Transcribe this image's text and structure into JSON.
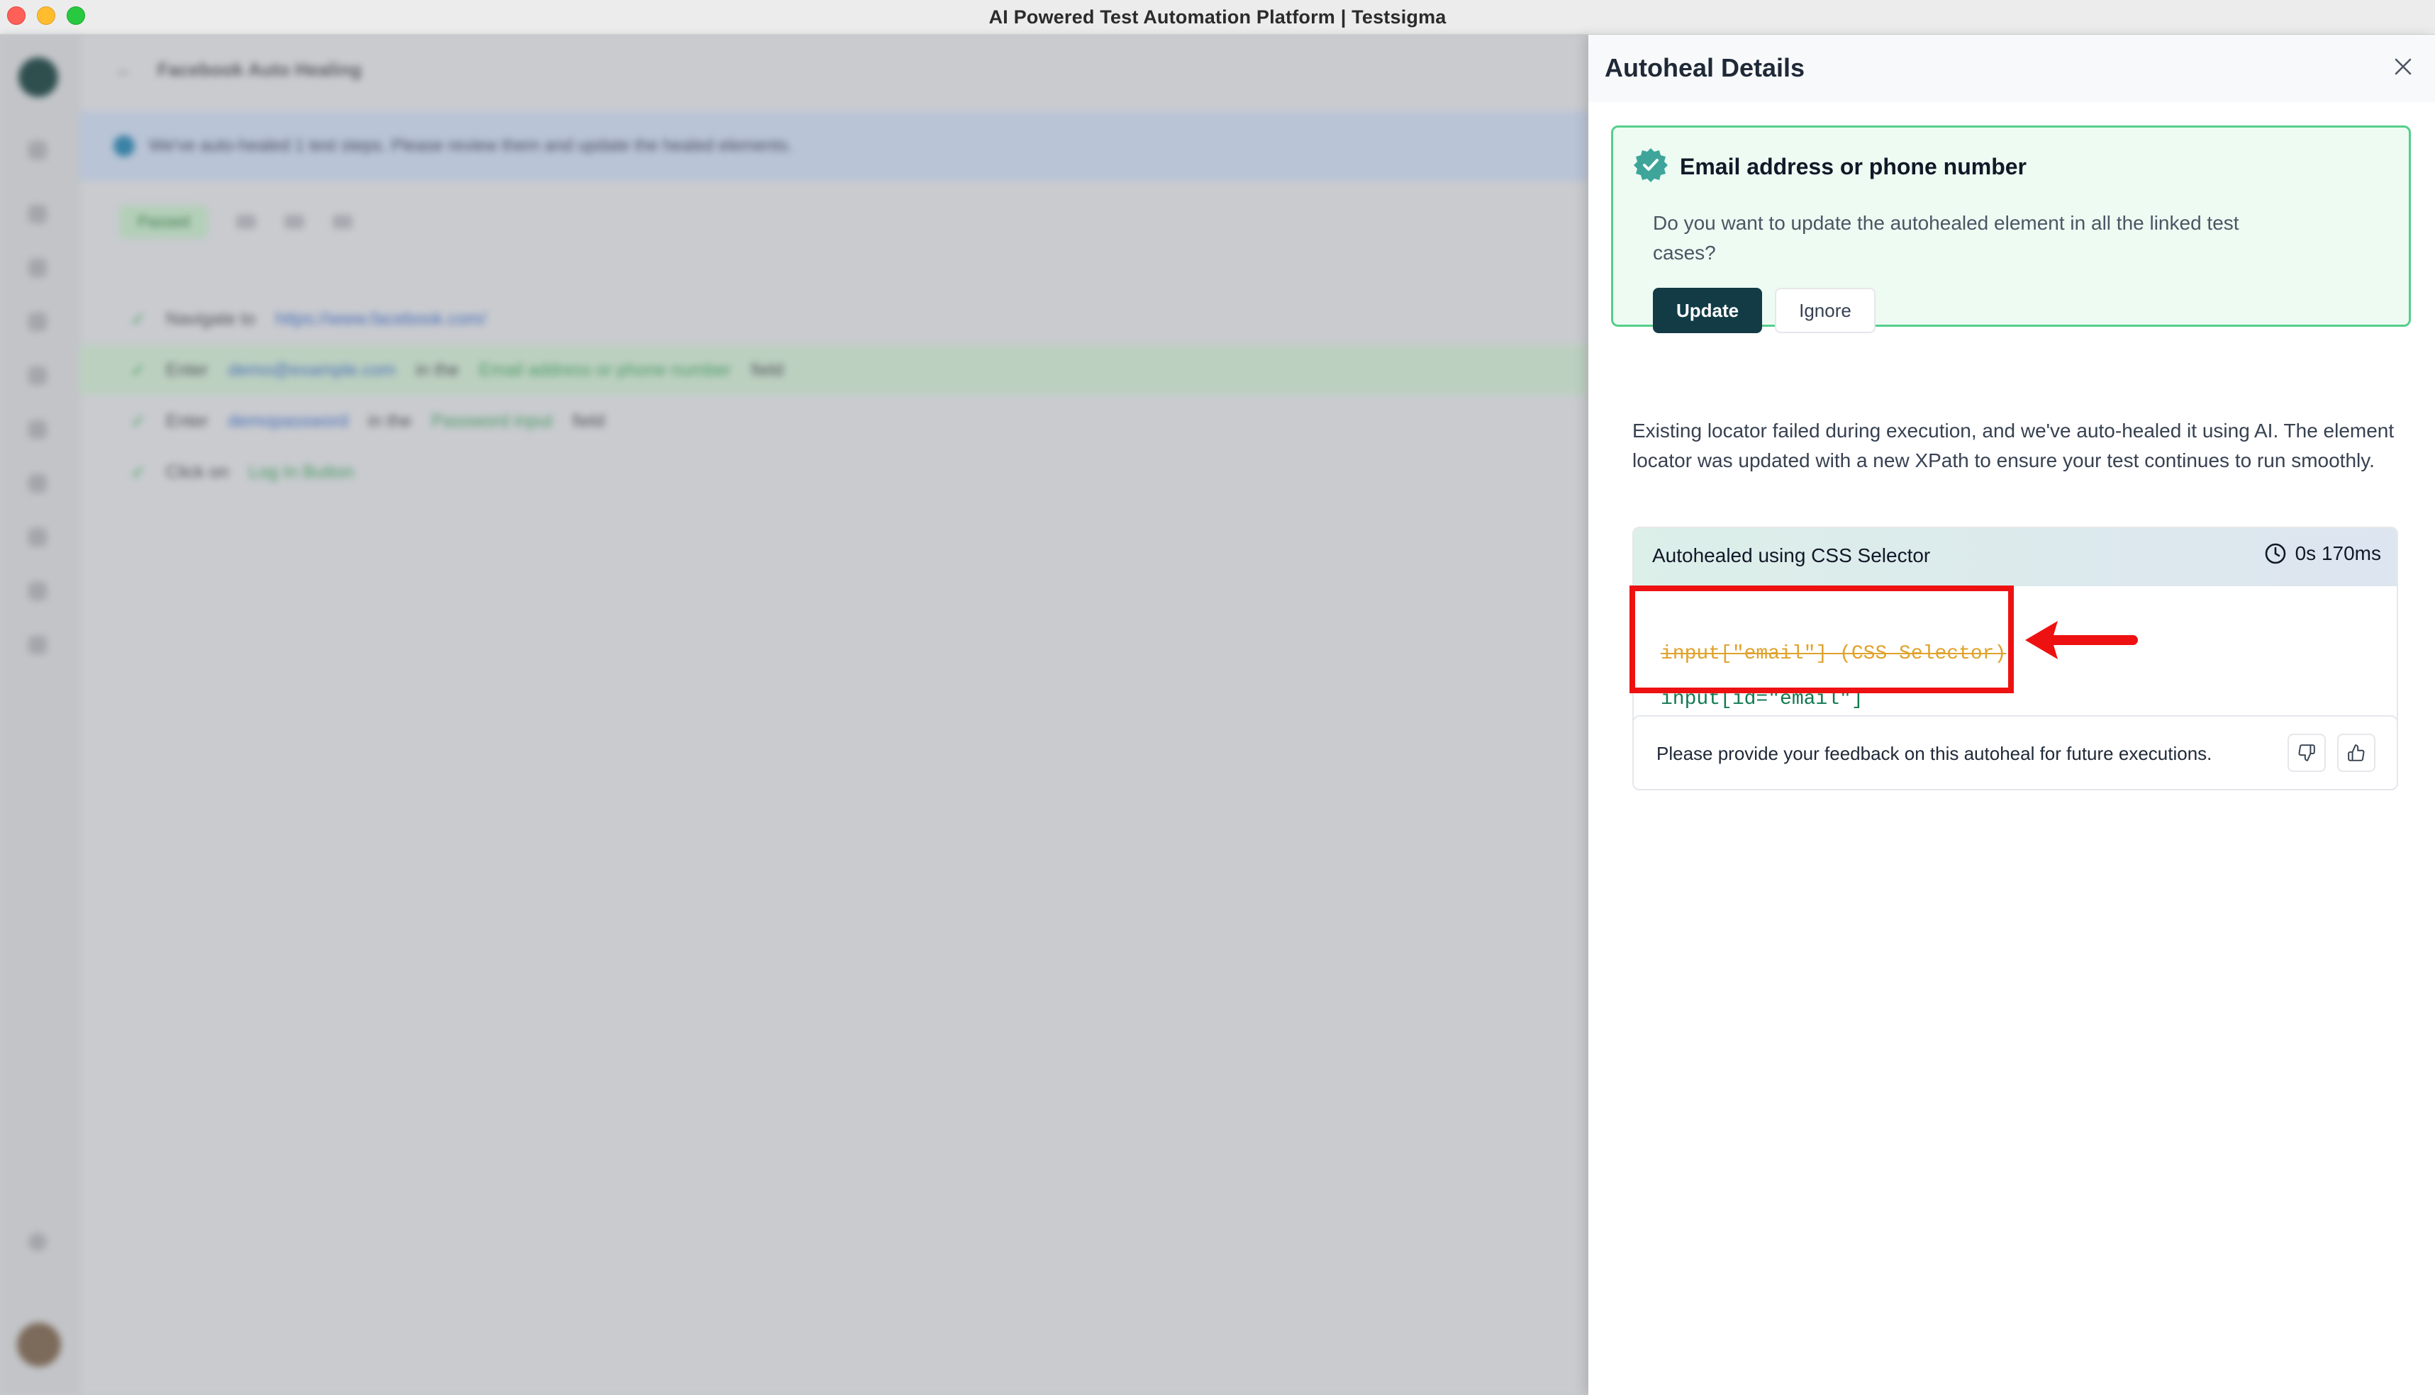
{
  "window": {
    "title": "AI Powered Test Automation Platform | Testsigma"
  },
  "background_app": {
    "test_case_title": "Facebook Auto Healing",
    "banner_text": "We've auto-healed 1 test steps. Please review them and update the healed elements.",
    "status_pill": "Passed",
    "steps": [
      {
        "action": "Navigate to",
        "value": "https://www.facebook.com/",
        "target": "",
        "suffix": ""
      },
      {
        "action": "Enter",
        "value": "demo@example.com",
        "mid": "in the",
        "target": "Email address or phone number",
        "suffix": "field"
      },
      {
        "action": "Enter",
        "value": "demopassword",
        "mid": "in the",
        "target": "Password input",
        "suffix": "field"
      },
      {
        "action": "Click on",
        "value": "",
        "mid": "",
        "target": "Log In Button",
        "suffix": ""
      }
    ]
  },
  "panel": {
    "title": "Autoheal Details",
    "alert": {
      "element_name": "Email address or phone number",
      "message": "Do you want to update the autohealed element in all the linked test cases?",
      "update_label": "Update",
      "ignore_label": "Ignore"
    },
    "description": "Existing locator failed during execution, and we've auto-healed it using AI. The element locator was updated with a new XPath to ensure your test continues to run smoothly.",
    "locator": {
      "heading": "Autohealed using CSS Selector",
      "duration": "0s 170ms",
      "old_locator": "input[\"email\"] (CSS Selector)",
      "new_locator": "input[id=\"email\"]"
    },
    "feedback": {
      "prompt": "Please provide your feedback on this autoheal for future executions."
    }
  },
  "colors": {
    "accent_dark": "#123b46",
    "success_border": "#55cf8a",
    "success_bg": "#edfbf3",
    "old_locator": "#e0a22c",
    "new_locator": "#137a4f",
    "annotation_red": "#ee1111"
  },
  "icons": {
    "close": "close-icon",
    "verified": "verified-badge-icon",
    "clock": "clock-icon",
    "thumbs_down": "thumbs-down-icon",
    "thumbs_up": "thumbs-up-icon"
  }
}
